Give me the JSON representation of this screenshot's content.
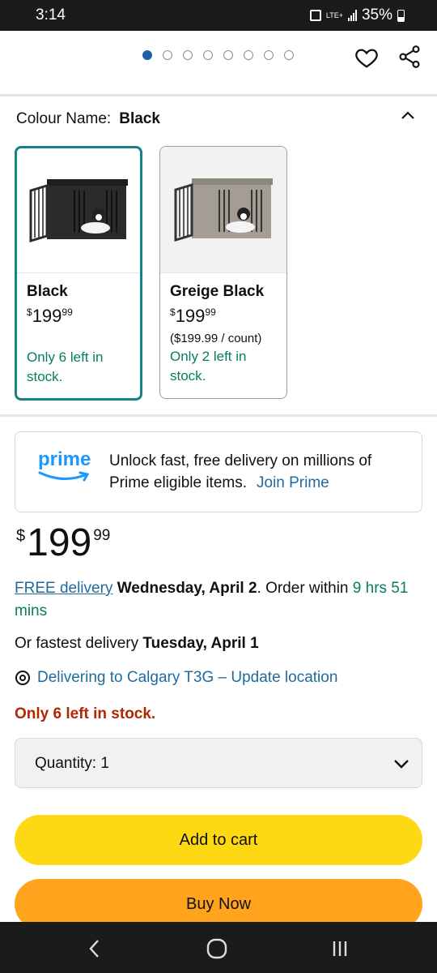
{
  "status": {
    "time": "3:14",
    "lte": "LTE+",
    "battery": "35%"
  },
  "carousel": {
    "count": 8,
    "active_index": 0
  },
  "colour": {
    "label": "Colour Name:",
    "value": "Black"
  },
  "swatches": [
    {
      "name": "Black",
      "price_symbol": "$",
      "price_whole": "199",
      "price_fraction": "99",
      "unit_price": "",
      "stock": "Only 6 left in stock.",
      "selected": true
    },
    {
      "name": "Greige Black",
      "price_symbol": "$",
      "price_whole": "199",
      "price_fraction": "99",
      "unit_price": "($199.99 / count)",
      "stock": "Only 2 left in stock.",
      "selected": false
    }
  ],
  "prime": {
    "logo": "prime",
    "text": "Unlock fast, free delivery on millions of Prime eligible items.",
    "link": "Join Prime"
  },
  "price": {
    "symbol": "$",
    "whole": "199",
    "fraction": "99"
  },
  "delivery": {
    "free_label": "FREE delivery",
    "date": "Wednesday, April 2",
    "order_within": ". Order within ",
    "countdown": "9 hrs 51 mins",
    "fastest_prefix": "Or fastest delivery ",
    "fastest_date": "Tuesday, April 1",
    "location": "Delivering to Calgary T3G – Update location"
  },
  "stock_message": "Only 6 left in stock.",
  "quantity": {
    "label": "Quantity:",
    "value": "1"
  },
  "buttons": {
    "add_to_cart": "Add to cart",
    "buy_now": "Buy Now"
  },
  "colors": {
    "prime_blue": "#1a98ff",
    "link": "#1f6b9c",
    "stock_green": "#067d62",
    "stock_red": "#b12704",
    "cart_yellow": "#ffd814",
    "buy_orange": "#ffa41c",
    "selected_border": "#1a7f86"
  }
}
